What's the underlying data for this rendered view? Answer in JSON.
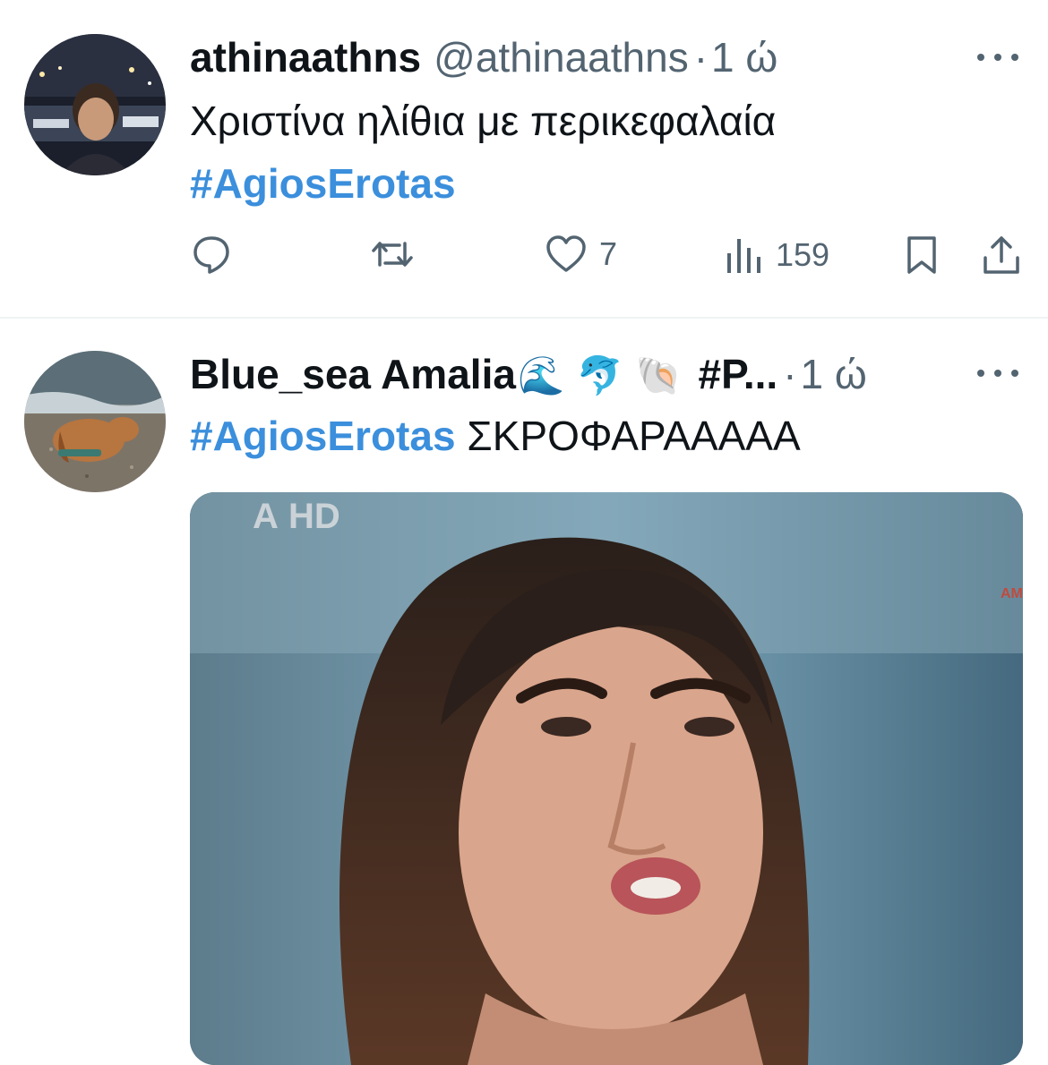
{
  "tweets": [
    {
      "display_name": "athinaathns",
      "handle": "@athinaathns",
      "separator": "·",
      "time": "1 ώ",
      "text_line1": "Χριστίνα ηλίθια με περικεφαλαία",
      "hashtag": "#AgiosErotas",
      "actions": {
        "reply_count": "",
        "retweet_count": "",
        "like_count": "7",
        "views_count": "159"
      },
      "avatar_icon": "avatar-night-harbor"
    },
    {
      "display_name": "Blue_sea Amalia",
      "name_emojis": "🌊 🐬 🐚",
      "name_hashtag": "#P...",
      "separator": "·",
      "time": "1 ώ",
      "hashtag": "#AgiosErotas",
      "text_after_hashtag": " ΣΚΡΟΦΑΡΑΑΑΑΑ",
      "avatar_icon": "avatar-dog-on-beach",
      "media_overlay": {
        "channel_logo": "Α HD",
        "corner_text": "AM"
      }
    }
  ],
  "colors": {
    "hashtag": "#3b8fdc",
    "secondary_text": "#536471",
    "divider": "#eff3f4"
  }
}
